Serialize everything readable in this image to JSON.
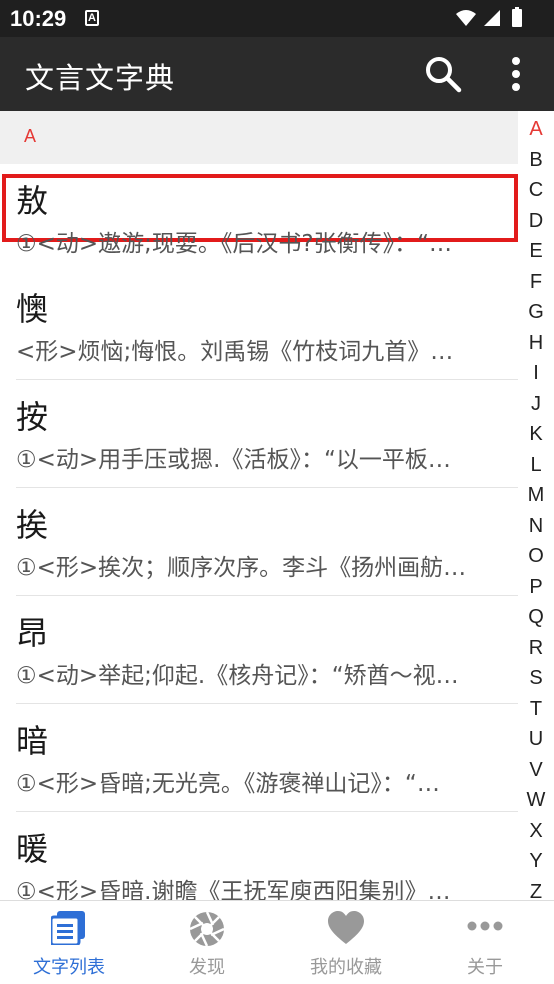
{
  "status_bar": {
    "time": "10:29",
    "notification_icon": "A"
  },
  "app_bar": {
    "title": "文言文字典",
    "search_icon": "search-icon",
    "more_icon": "more-vertical-icon"
  },
  "section": {
    "letter": "A"
  },
  "entries": [
    {
      "char": "敖",
      "def": "①<动>遨游;现耍。《后汉书?张衡传》：“…"
    },
    {
      "char": "懊",
      "def": "<形>烦恼;悔恨。刘禹锡《竹枝词九首》…"
    },
    {
      "char": "按",
      "def": "①<动>用手压或摁.《活板》：“以一平板…"
    },
    {
      "char": "挨",
      "def": "①<形>挨次；顺序次序。李斗《扬州画舫…"
    },
    {
      "char": "昂",
      "def": "①<动>举起;仰起.《核舟记》：“矫酋～视…"
    },
    {
      "char": "暗",
      "def": "①<形>昏暗;无光亮。《游褒禅山记》：“…"
    },
    {
      "char": "暖",
      "def": "①<形>昏暗.谢瞻《王抚军庾西阳集别》…"
    }
  ],
  "alphabet": [
    "A",
    "B",
    "C",
    "D",
    "E",
    "F",
    "G",
    "H",
    "I",
    "J",
    "K",
    "L",
    "M",
    "N",
    "O",
    "P",
    "Q",
    "R",
    "S",
    "T",
    "U",
    "V",
    "W",
    "X",
    "Y",
    "Z"
  ],
  "active_letter": "A",
  "bottom_nav": [
    {
      "label": "文字列表",
      "icon": "list-icon",
      "active": true
    },
    {
      "label": "发现",
      "icon": "aperture-icon",
      "active": false
    },
    {
      "label": "我的收藏",
      "icon": "heart-icon",
      "active": false
    },
    {
      "label": "关于",
      "icon": "more-horizontal-icon",
      "active": false
    }
  ],
  "colors": {
    "accent": "#e53935",
    "nav_active": "#2e6fd6",
    "app_bar": "#2b2b2b",
    "selection": "#e21b1b"
  }
}
